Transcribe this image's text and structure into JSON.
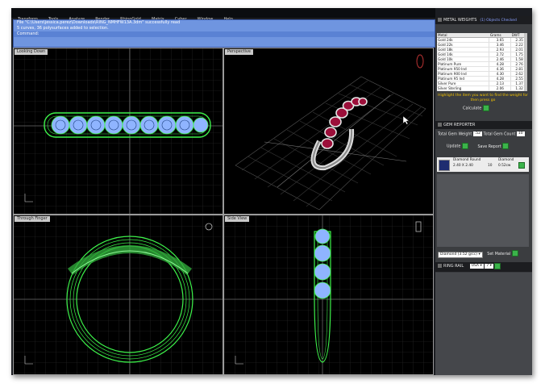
{
  "menu": [
    "Transform",
    "Tools",
    "Analyze",
    "Render",
    "RhinoGold",
    "Matrix",
    "Cyber",
    "Window",
    "Help"
  ],
  "command": {
    "line1": "File \"C:\\Users\\jessica.perez\\Downloads\\RING_NMHFW13A.3dm\" successfully read",
    "line2": "5 curves, 36 polysurfaces added to selection.",
    "prompt": "Command:"
  },
  "viewports": {
    "top": "Looking Down",
    "perspective": "Perspective",
    "front": "Through Finger",
    "right": "Side View"
  },
  "metal_weights": {
    "title": "METAL WEIGHTS",
    "subtitle": "(1) Objects Checked",
    "columns": [
      "Metal",
      "Grams",
      "DWT"
    ],
    "rows": [
      [
        "Gold 24k",
        "3.65",
        "2.35"
      ],
      [
        "Gold 22k",
        "3.46",
        "2.22"
      ],
      [
        "Gold 18k",
        "2.93",
        "2.01"
      ],
      [
        "Gold 14k",
        "2.72",
        "1.75"
      ],
      [
        "Gold 10k",
        "2.46",
        "1.58"
      ],
      [
        "Platinum Pure",
        "4.28",
        "2.76"
      ],
      [
        "Platinum 950 Ind",
        "4.36",
        "2.81"
      ],
      [
        "Platinum 900 Ind",
        "4.30",
        "2.62"
      ],
      [
        "Platinum 95 Ind",
        "4.28",
        "2.55"
      ],
      [
        "Silver Pure",
        "2.13",
        "1.37"
      ],
      [
        "Silver Sterling",
        "2.06",
        "1.32"
      ]
    ],
    "hint": "Highlight the item you want to find the weight for then press go",
    "calculate": "Calculate"
  },
  "gem_reporter": {
    "title": "GEM REPORTER",
    "total_weight_label": "Total Gem Weight",
    "total_weight": ".52",
    "total_count_label": "Total Gem Count",
    "total_count": "10",
    "update": "Update",
    "save": "Save Report",
    "gem": {
      "name": "Diamond Round",
      "dims": "2.40 X 2.40",
      "count": "10",
      "material": "Diamond",
      "weight": "0.52cw"
    },
    "material_select": "Diamond",
    "material_value": "(3.52 g/cc)",
    "set_material": "Set Material"
  },
  "ring_rail": {
    "title": "RING RAIL",
    "system": "USA",
    "size": "7"
  },
  "colors": {
    "cmd_bg": "#6f95e0",
    "panel_bg": "#3b3d40",
    "wire": "#3df24a",
    "gem_blue": "#8fb4ff",
    "ruby": "#9c0f3a",
    "hint": "#f2c200"
  }
}
